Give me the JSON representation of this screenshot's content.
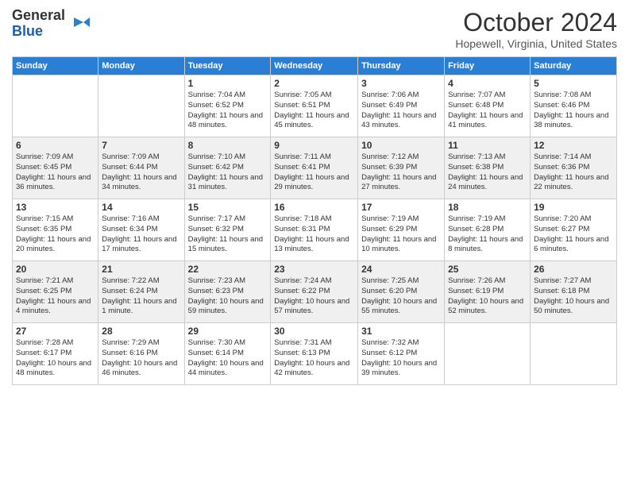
{
  "header": {
    "logo_line1": "General",
    "logo_line2": "Blue",
    "month_title": "October 2024",
    "location": "Hopewell, Virginia, United States"
  },
  "days_of_week": [
    "Sunday",
    "Monday",
    "Tuesday",
    "Wednesday",
    "Thursday",
    "Friday",
    "Saturday"
  ],
  "weeks": [
    [
      {
        "day": "",
        "info": ""
      },
      {
        "day": "",
        "info": ""
      },
      {
        "day": "1",
        "info": "Sunrise: 7:04 AM\nSunset: 6:52 PM\nDaylight: 11 hours and 48 minutes."
      },
      {
        "day": "2",
        "info": "Sunrise: 7:05 AM\nSunset: 6:51 PM\nDaylight: 11 hours and 45 minutes."
      },
      {
        "day": "3",
        "info": "Sunrise: 7:06 AM\nSunset: 6:49 PM\nDaylight: 11 hours and 43 minutes."
      },
      {
        "day": "4",
        "info": "Sunrise: 7:07 AM\nSunset: 6:48 PM\nDaylight: 11 hours and 41 minutes."
      },
      {
        "day": "5",
        "info": "Sunrise: 7:08 AM\nSunset: 6:46 PM\nDaylight: 11 hours and 38 minutes."
      }
    ],
    [
      {
        "day": "6",
        "info": "Sunrise: 7:09 AM\nSunset: 6:45 PM\nDaylight: 11 hours and 36 minutes."
      },
      {
        "day": "7",
        "info": "Sunrise: 7:09 AM\nSunset: 6:44 PM\nDaylight: 11 hours and 34 minutes."
      },
      {
        "day": "8",
        "info": "Sunrise: 7:10 AM\nSunset: 6:42 PM\nDaylight: 11 hours and 31 minutes."
      },
      {
        "day": "9",
        "info": "Sunrise: 7:11 AM\nSunset: 6:41 PM\nDaylight: 11 hours and 29 minutes."
      },
      {
        "day": "10",
        "info": "Sunrise: 7:12 AM\nSunset: 6:39 PM\nDaylight: 11 hours and 27 minutes."
      },
      {
        "day": "11",
        "info": "Sunrise: 7:13 AM\nSunset: 6:38 PM\nDaylight: 11 hours and 24 minutes."
      },
      {
        "day": "12",
        "info": "Sunrise: 7:14 AM\nSunset: 6:36 PM\nDaylight: 11 hours and 22 minutes."
      }
    ],
    [
      {
        "day": "13",
        "info": "Sunrise: 7:15 AM\nSunset: 6:35 PM\nDaylight: 11 hours and 20 minutes."
      },
      {
        "day": "14",
        "info": "Sunrise: 7:16 AM\nSunset: 6:34 PM\nDaylight: 11 hours and 17 minutes."
      },
      {
        "day": "15",
        "info": "Sunrise: 7:17 AM\nSunset: 6:32 PM\nDaylight: 11 hours and 15 minutes."
      },
      {
        "day": "16",
        "info": "Sunrise: 7:18 AM\nSunset: 6:31 PM\nDaylight: 11 hours and 13 minutes."
      },
      {
        "day": "17",
        "info": "Sunrise: 7:19 AM\nSunset: 6:29 PM\nDaylight: 11 hours and 10 minutes."
      },
      {
        "day": "18",
        "info": "Sunrise: 7:19 AM\nSunset: 6:28 PM\nDaylight: 11 hours and 8 minutes."
      },
      {
        "day": "19",
        "info": "Sunrise: 7:20 AM\nSunset: 6:27 PM\nDaylight: 11 hours and 6 minutes."
      }
    ],
    [
      {
        "day": "20",
        "info": "Sunrise: 7:21 AM\nSunset: 6:25 PM\nDaylight: 11 hours and 4 minutes."
      },
      {
        "day": "21",
        "info": "Sunrise: 7:22 AM\nSunset: 6:24 PM\nDaylight: 11 hours and 1 minute."
      },
      {
        "day": "22",
        "info": "Sunrise: 7:23 AM\nSunset: 6:23 PM\nDaylight: 10 hours and 59 minutes."
      },
      {
        "day": "23",
        "info": "Sunrise: 7:24 AM\nSunset: 6:22 PM\nDaylight: 10 hours and 57 minutes."
      },
      {
        "day": "24",
        "info": "Sunrise: 7:25 AM\nSunset: 6:20 PM\nDaylight: 10 hours and 55 minutes."
      },
      {
        "day": "25",
        "info": "Sunrise: 7:26 AM\nSunset: 6:19 PM\nDaylight: 10 hours and 52 minutes."
      },
      {
        "day": "26",
        "info": "Sunrise: 7:27 AM\nSunset: 6:18 PM\nDaylight: 10 hours and 50 minutes."
      }
    ],
    [
      {
        "day": "27",
        "info": "Sunrise: 7:28 AM\nSunset: 6:17 PM\nDaylight: 10 hours and 48 minutes."
      },
      {
        "day": "28",
        "info": "Sunrise: 7:29 AM\nSunset: 6:16 PM\nDaylight: 10 hours and 46 minutes."
      },
      {
        "day": "29",
        "info": "Sunrise: 7:30 AM\nSunset: 6:14 PM\nDaylight: 10 hours and 44 minutes."
      },
      {
        "day": "30",
        "info": "Sunrise: 7:31 AM\nSunset: 6:13 PM\nDaylight: 10 hours and 42 minutes."
      },
      {
        "day": "31",
        "info": "Sunrise: 7:32 AM\nSunset: 6:12 PM\nDaylight: 10 hours and 39 minutes."
      },
      {
        "day": "",
        "info": ""
      },
      {
        "day": "",
        "info": ""
      }
    ]
  ]
}
